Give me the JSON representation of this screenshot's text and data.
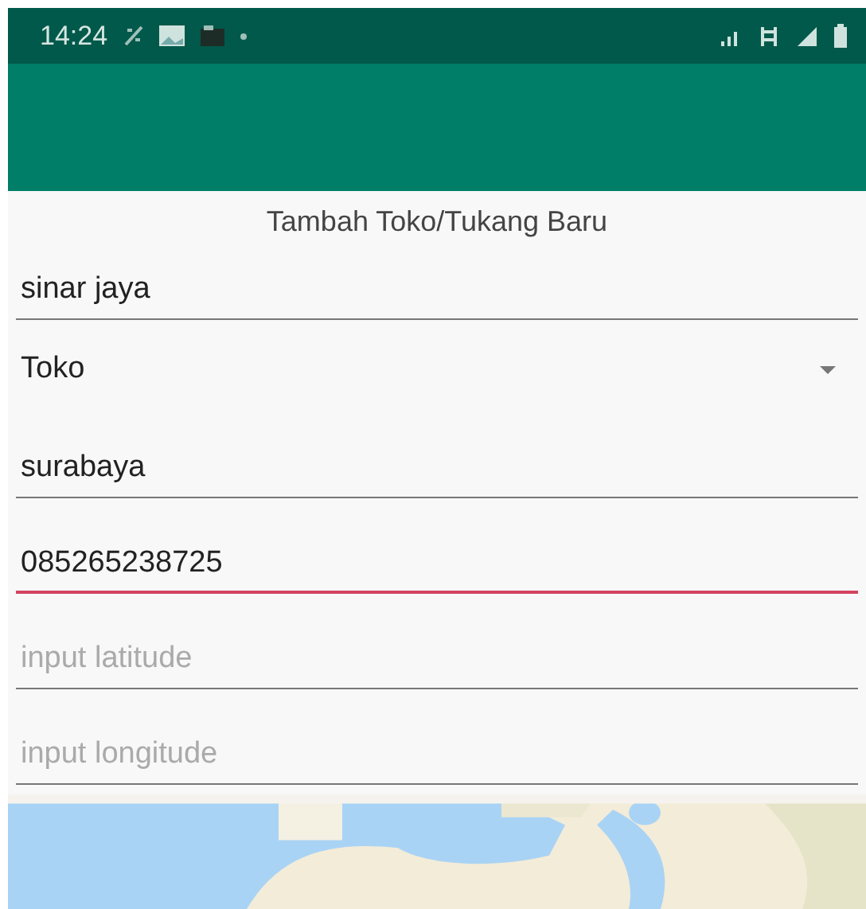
{
  "status_bar": {
    "time": "14:24"
  },
  "form": {
    "title": "Tambah Toko/Tukang Baru",
    "fields": [
      {
        "kind": "text",
        "value": "sinar jaya",
        "focused": false
      },
      {
        "kind": "dropdown",
        "value": "Toko",
        "focused": false
      },
      {
        "kind": "text",
        "value": "surabaya",
        "focused": false
      },
      {
        "kind": "text",
        "value": "085265238725",
        "focused": true
      },
      {
        "kind": "text",
        "placeholder": "input latitude",
        "focused": false
      },
      {
        "kind": "text",
        "placeholder": "input longitude",
        "focused": false
      }
    ]
  }
}
